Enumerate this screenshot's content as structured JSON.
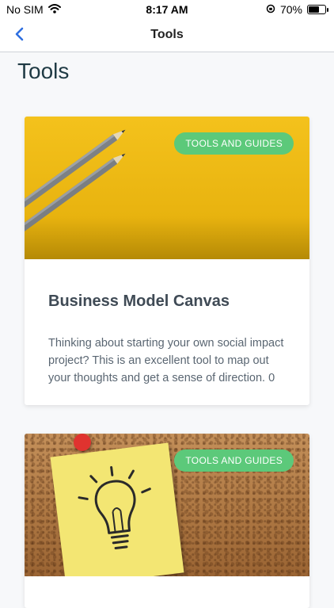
{
  "status_bar": {
    "carrier": "No SIM",
    "time": "8:17 AM",
    "battery_percent": "70%",
    "battery_level": 0.7
  },
  "nav": {
    "title": "Tools",
    "back_icon": "chevron-left-icon"
  },
  "page": {
    "title": "Tools"
  },
  "colors": {
    "accent": "#2f6fe0",
    "tag": "#5cc97a",
    "title": "#1f3a44"
  },
  "cards": [
    {
      "tag": "TOOLS AND GUIDES",
      "title": "Business Model Canvas",
      "description": "Thinking about starting your own social impact project? This is an excellent tool to map out your thoughts and get a sense of direction. 0"
    },
    {
      "tag": "TOOLS AND GUIDES"
    }
  ]
}
